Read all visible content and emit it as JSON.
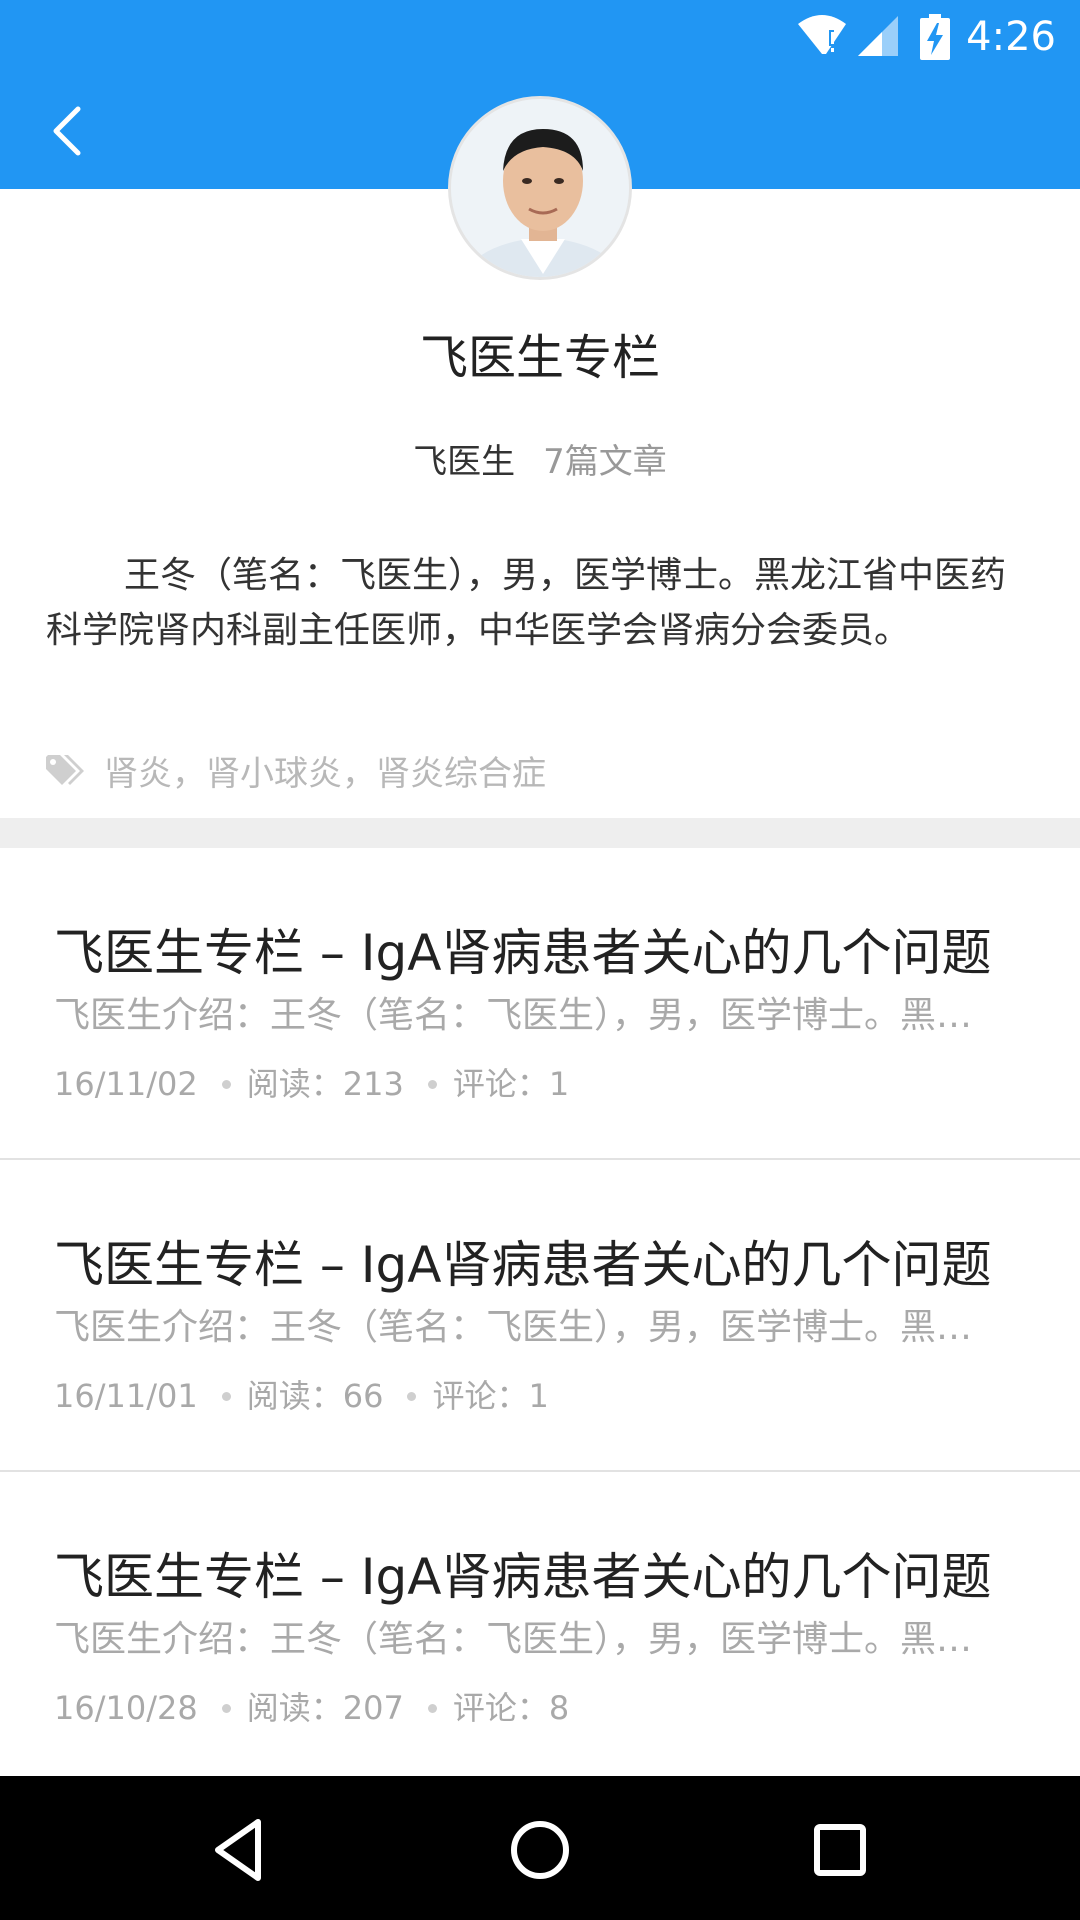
{
  "status_bar": {
    "time": "4:26",
    "icons": [
      "wifi-icon",
      "signal-icon",
      "battery-charging-icon"
    ]
  },
  "header": {
    "back_icon": "chevron-left-icon",
    "background_color": "#2196F3"
  },
  "profile": {
    "avatar": "doctor-avatar",
    "column_title": "飞医生专栏",
    "author_name": "飞医生",
    "article_count": "7篇文章",
    "bio": "王冬（笔名：飞医生），男，医学博士。黑龙江省中医药科学院肾内科副主任医师，中华医学会肾病分会委员。",
    "tag_icon": "tag-icon",
    "tags": "肾炎，肾小球炎，肾炎综合症"
  },
  "articles": [
    {
      "title": "飞医生专栏 – IgA肾病患者关心的几个问题",
      "summary": "飞医生介绍：王冬（笔名：飞医生），男，医学博士。黑龙江省中医药科学院",
      "date": "16/11/02",
      "reads": "阅读：213",
      "comments": "评论：1"
    },
    {
      "title": "飞医生专栏 – IgA肾病患者关心的几个问题",
      "summary": "飞医生介绍：王冬（笔名：飞医生），男，医学博士。黑龙江省中医药科学院",
      "date": "16/11/01",
      "reads": "阅读：66",
      "comments": "评论：1"
    },
    {
      "title": "飞医生专栏 – IgA肾病患者关心的几个问题",
      "summary": "飞医生介绍：王冬（笔名：飞医生），男，医学博士。黑龙江省中医药科学院",
      "date": "16/10/28",
      "reads": "阅读：207",
      "comments": "评论：8"
    }
  ],
  "nav_bar": {
    "icons": [
      "back-triangle-icon",
      "home-circle-icon",
      "recents-square-icon"
    ]
  }
}
